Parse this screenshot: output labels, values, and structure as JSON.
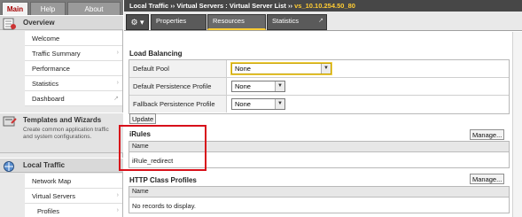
{
  "sidebar": {
    "tabs": [
      {
        "label": "Main",
        "active": true
      },
      {
        "label": "Help",
        "active": false
      },
      {
        "label": "About",
        "active": false
      }
    ],
    "sections": [
      {
        "title": "Overview",
        "icon": "overview-icon",
        "items": [
          {
            "label": "Welcome",
            "chevron": ""
          },
          {
            "label": "Traffic Summary",
            "chevron": "›"
          },
          {
            "label": "Performance",
            "chevron": ""
          },
          {
            "label": "Statistics",
            "chevron": "›"
          },
          {
            "label": "Dashboard",
            "chevron": "↗"
          }
        ]
      },
      {
        "title": "Templates and Wizards",
        "icon": "templates-icon",
        "description": "Create common application traffic and system configurations."
      },
      {
        "title": "Local Traffic",
        "icon": "local-traffic-icon",
        "items": [
          {
            "label": "Network Map",
            "chevron": ""
          },
          {
            "label": "Virtual Servers",
            "chevron": "›"
          },
          {
            "label": "Profiles",
            "chevron": "›"
          }
        ]
      }
    ]
  },
  "breadcrumb": {
    "part1": "Local Traffic",
    "sep1": "››",
    "part2": "Virtual Servers : Virtual Server List",
    "sep2": "››",
    "current": "vs_10.10.254.50_80"
  },
  "tabs": [
    {
      "label": "Properties",
      "active": false
    },
    {
      "label": "Resources",
      "active": true
    },
    {
      "label": "Statistics",
      "active": false,
      "popout": "↗"
    }
  ],
  "gear_label": "⚙ ▾",
  "load_balancing": {
    "title": "Load Balancing",
    "rows": [
      {
        "label": "Default Pool",
        "value": "None"
      },
      {
        "label": "Default Persistence Profile",
        "value": "None"
      },
      {
        "label": "Fallback Persistence Profile",
        "value": "None"
      }
    ],
    "update_label": "Update"
  },
  "irules": {
    "title": "iRules",
    "manage_label": "Manage...",
    "column": "Name",
    "rows": [
      "iRule_redirect"
    ]
  },
  "http_class": {
    "title": "HTTP Class Profiles",
    "manage_label": "Manage...",
    "column": "Name",
    "empty_text": "No records to display."
  },
  "colors": {
    "accent": "#ffcc33",
    "active_tab_text": "#a40000",
    "highlight": "#d8101a"
  }
}
